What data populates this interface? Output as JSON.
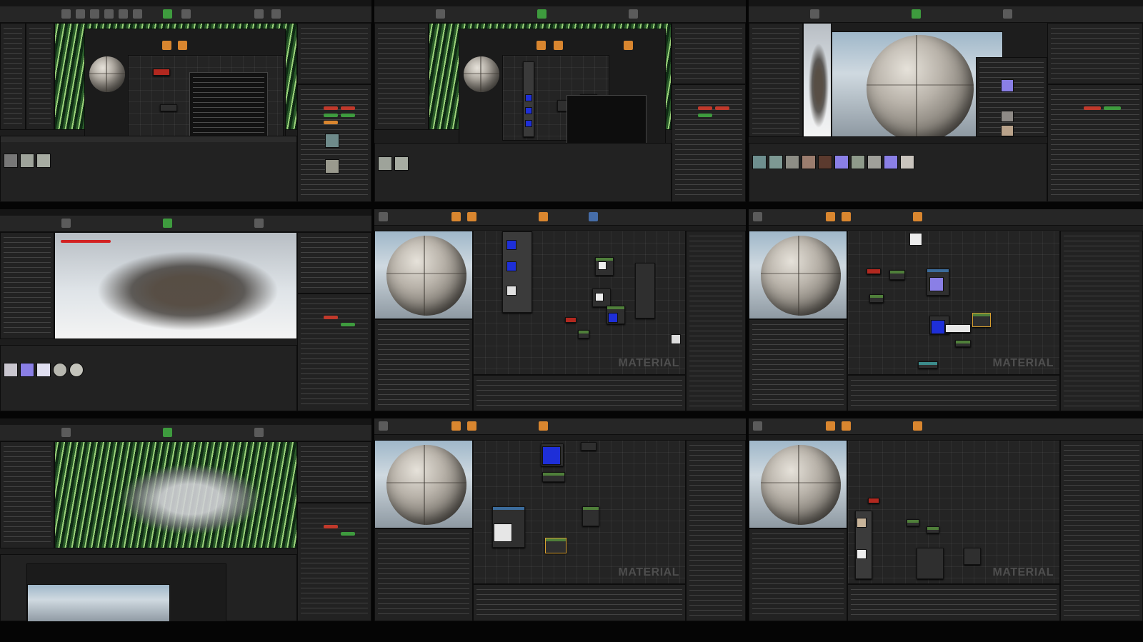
{
  "tiles": [
    {
      "row": 1,
      "col": 1,
      "view": "level-editor",
      "viewport": "streak",
      "popup": "context-menu"
    },
    {
      "row": 1,
      "col": 2,
      "view": "material-editor",
      "graph": "texture-nodes"
    },
    {
      "row": 1,
      "col": 3,
      "view": "material-preview",
      "preview": "large-sphere"
    },
    {
      "row": 2,
      "col": 1,
      "view": "level-editor",
      "viewport": "scene"
    },
    {
      "row": 2,
      "col": 2,
      "view": "material-editor",
      "graph": "nodes"
    },
    {
      "row": 2,
      "col": 3,
      "view": "material-editor",
      "graph": "nodes"
    },
    {
      "row": 3,
      "col": 1,
      "view": "level-editor",
      "viewport": "streak"
    },
    {
      "row": 3,
      "col": 2,
      "view": "material-editor",
      "graph": "nodes"
    },
    {
      "row": 3,
      "col": 3,
      "view": "material-editor",
      "graph": "nodes"
    }
  ],
  "graph_watermark": "MATERIAL",
  "colors": {
    "background": "#1d1d1d",
    "toolbar": "#262626",
    "accent_orange": "#d9862f",
    "accent_green": "#3e9b3e",
    "node_blue": "#1e2fd8",
    "node_lavender": "#8a7fe6",
    "warning_red": "#d22222"
  }
}
